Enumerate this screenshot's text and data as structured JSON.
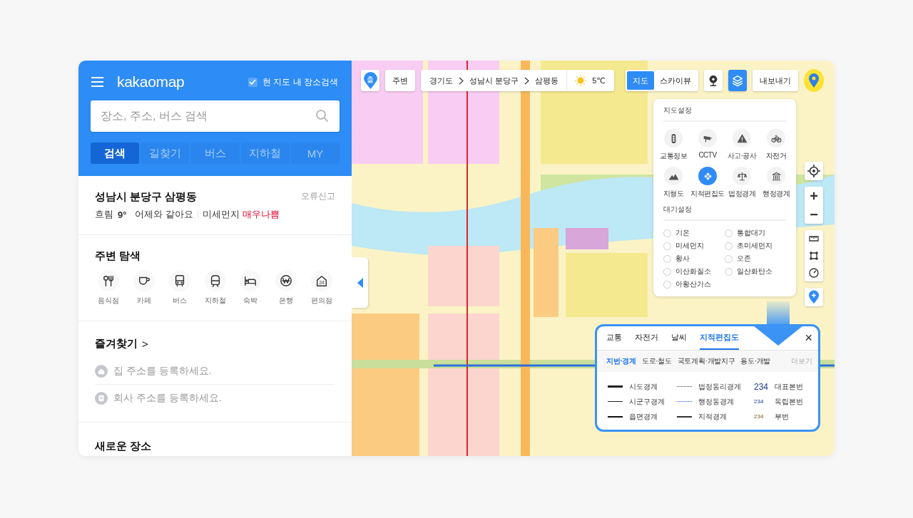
{
  "sidebar": {
    "logo": "kakaomap",
    "area_search": {
      "label": "현 지도 내 장소검색",
      "checked": true
    },
    "search": {
      "placeholder": "장소, 주소, 버스 검색"
    },
    "tabs": [
      {
        "label": "검색",
        "selected": true
      },
      {
        "label": "길찾기",
        "selected": false
      },
      {
        "label": "버스",
        "selected": false
      },
      {
        "label": "지하철",
        "selected": false
      },
      {
        "label": "MY",
        "selected": false
      }
    ],
    "location": {
      "title": "성남시 분당구 삼평동",
      "report": "오류신고",
      "weather": "흐림",
      "temperature": "9°",
      "compare": "어제와 같아요",
      "dust_label": "미세먼지",
      "dust_value": "매우나쁨"
    },
    "nearby": {
      "title": "주변 탐색",
      "items": [
        {
          "kind": "restaurant",
          "label": "음식점"
        },
        {
          "kind": "cafe",
          "label": "카페"
        },
        {
          "kind": "bus",
          "label": "버스"
        },
        {
          "kind": "subway",
          "label": "지하철"
        },
        {
          "kind": "lodging",
          "label": "숙박"
        },
        {
          "kind": "bank",
          "label": "은행"
        },
        {
          "kind": "convenience",
          "label": "편의점",
          "icon_text": "24"
        }
      ]
    },
    "favorites": {
      "title": "즐겨찾기",
      "chevron": ">",
      "items": [
        {
          "kind": "home",
          "label": "집 주소를 등록하세요."
        },
        {
          "kind": "office",
          "label": "회사 주소를 등록하세요."
        }
      ]
    },
    "new_places": {
      "title": "새로운 장소"
    }
  },
  "map": {
    "kind": "picture",
    "top_bar": {
      "start_marker": "출",
      "nearby": "주변",
      "breadcrumb": [
        "경기도",
        "성남시 분당구",
        "삼평동"
      ],
      "temperature": "5℃",
      "views": [
        {
          "label": "지도",
          "selected": true
        },
        {
          "label": "스카이뷰",
          "selected": false
        }
      ],
      "tools": [
        {
          "kind": "roadview",
          "selected": false
        },
        {
          "kind": "layers",
          "selected": true
        }
      ],
      "export": "내보내기"
    },
    "settings": {
      "title": "지도설정",
      "layers": [
        {
          "kind": "traffic",
          "label": "교통정보",
          "selected": false
        },
        {
          "kind": "cctv",
          "label": "CCTV",
          "selected": false
        },
        {
          "kind": "accident",
          "label": "사고·공사",
          "selected": false
        },
        {
          "kind": "bicycle",
          "label": "자전거",
          "selected": false
        },
        {
          "kind": "terrain",
          "label": "지형도",
          "selected": false
        },
        {
          "kind": "cadastral",
          "label": "지적편집도",
          "selected": true
        },
        {
          "kind": "legal_boundary",
          "label": "법정경계",
          "selected": false
        },
        {
          "kind": "admin_boundary",
          "label": "행정경계",
          "selected": false
        }
      ],
      "air_title": "대기설정",
      "air_options": [
        {
          "label": "기온",
          "checked": false
        },
        {
          "label": "통합대기",
          "checked": false
        },
        {
          "label": "미세먼지",
          "checked": false
        },
        {
          "label": "초미세먼지",
          "checked": false
        },
        {
          "label": "황사",
          "checked": false
        },
        {
          "label": "오존",
          "checked": false
        },
        {
          "label": "이산화질소",
          "checked": false
        },
        {
          "label": "일산화탄소",
          "checked": false
        },
        {
          "label": "아황산가스",
          "checked": false
        }
      ]
    },
    "zoom": {
      "in": "+",
      "out": "−"
    },
    "legend_panel": {
      "close": "×",
      "more": "더보기",
      "tabs": [
        {
          "label": "교통",
          "selected": false
        },
        {
          "label": "자전거",
          "selected": false
        },
        {
          "label": "날씨",
          "selected": false
        },
        {
          "label": "지적편집도",
          "selected": true
        }
      ],
      "subtabs": [
        {
          "label": "지번·경계",
          "selected": true
        },
        {
          "label": "도로·철도",
          "selected": false
        },
        {
          "label": "국토계획·개발지구",
          "selected": false
        },
        {
          "label": "용도·개발",
          "selected": false
        }
      ],
      "items": [
        {
          "kind": "thick",
          "label": "시도경계"
        },
        {
          "kind": "dotted",
          "label": "법정동리경계"
        },
        {
          "kind": "number_main",
          "sample": "234",
          "label": "대표본번"
        },
        {
          "kind": "thin",
          "label": "시군구경계"
        },
        {
          "kind": "dotted_blue",
          "label": "행정동경계"
        },
        {
          "kind": "number_single",
          "sample": "234",
          "label": "독립본번"
        },
        {
          "kind": "medium",
          "label": "읍면경계"
        },
        {
          "kind": "solid",
          "label": "지적경계"
        },
        {
          "kind": "number_sub",
          "sample": "234",
          "label": "부번"
        }
      ]
    }
  }
}
